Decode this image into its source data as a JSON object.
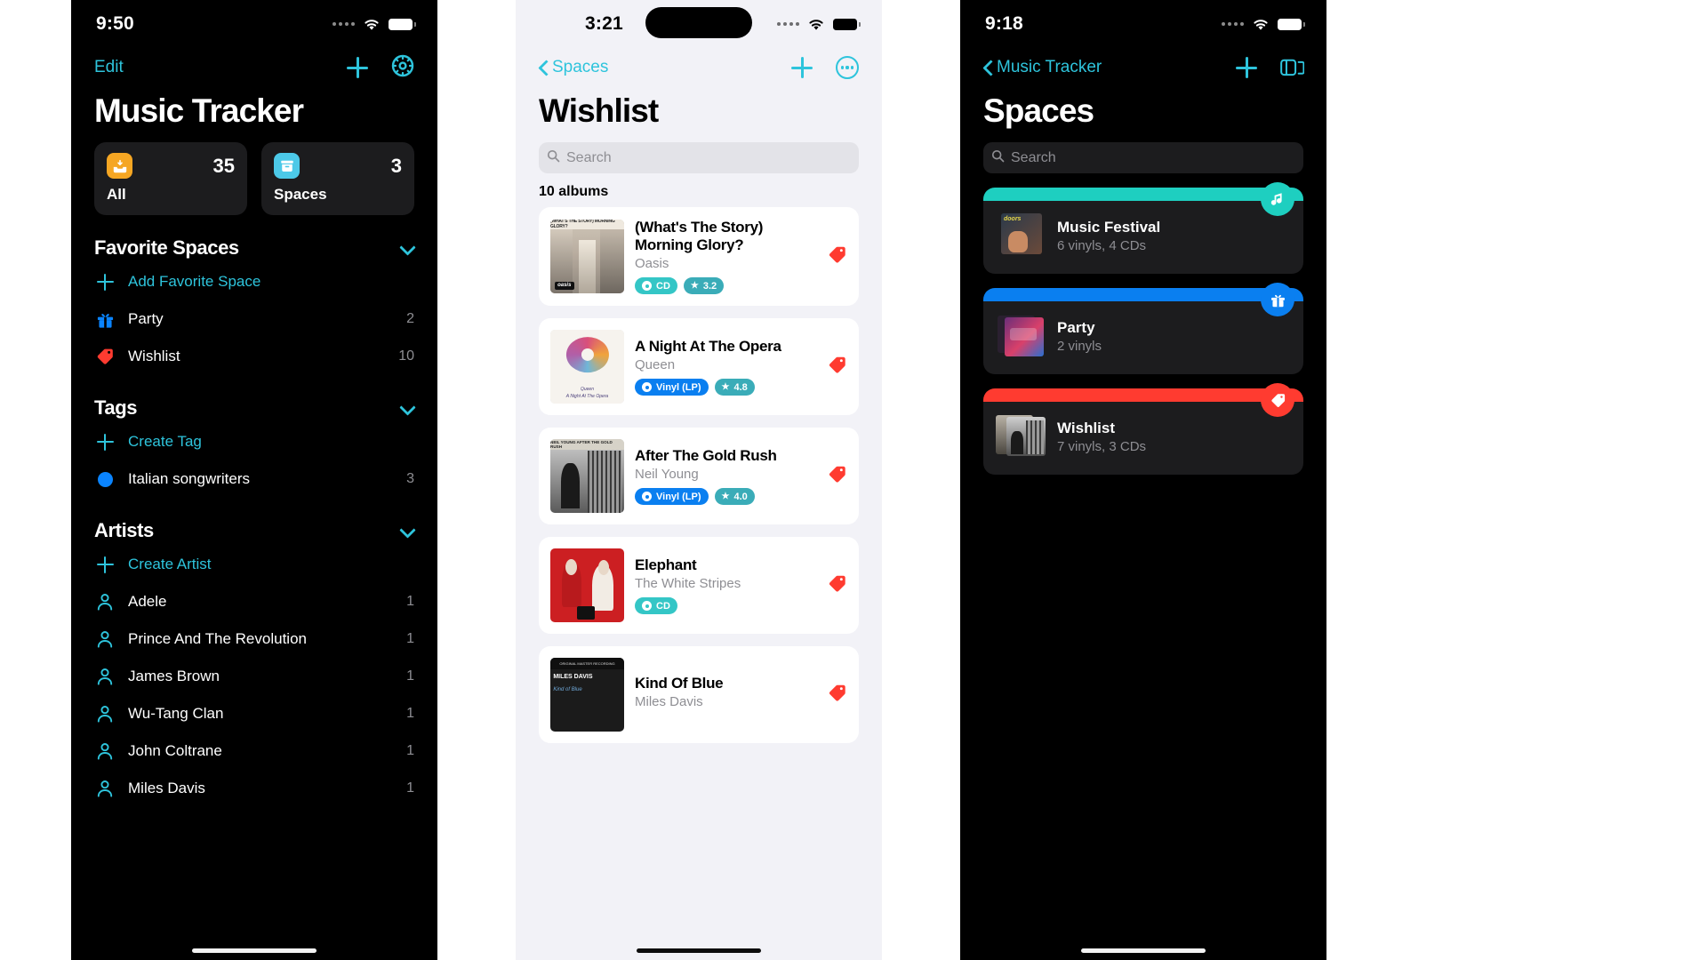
{
  "theme": {
    "accent_teal": "#2ec4dc",
    "accent_blue": "#0a84ff",
    "red": "#ff3b30",
    "orange": "#f5a623",
    "cyan": "#4cc9e8",
    "mint": "#1ecfc0",
    "card_dark": "#1c1c1e",
    "light_bg": "#f2f2f7"
  },
  "panel1": {
    "status": {
      "time": "9:50",
      "signal_icon": "signal-dots-icon",
      "wifi_icon": "wifi-icon",
      "battery_icon": "battery-icon"
    },
    "nav": {
      "edit_label": "Edit",
      "add_icon": "plus-icon",
      "settings_icon": "gear-icon"
    },
    "title": "Music Tracker",
    "stats": [
      {
        "label": "All",
        "count": "35",
        "icon": "inbox-icon",
        "color": "#f5a623"
      },
      {
        "label": "Spaces",
        "count": "3",
        "icon": "archive-box-icon",
        "color": "#4cc9e8"
      }
    ],
    "sections": [
      {
        "title": "Favorite Spaces",
        "collapse_icon": "chevron-down-icon",
        "add_label": "Add Favorite Space",
        "add_icon": "plus-icon",
        "rows": [
          {
            "label": "Party",
            "count": "2",
            "icon": "gift-icon",
            "color": "#0a84ff"
          },
          {
            "label": "Wishlist",
            "count": "10",
            "icon": "tag-icon",
            "color": "#ff3b30"
          }
        ]
      },
      {
        "title": "Tags",
        "collapse_icon": "chevron-down-icon",
        "add_label": "Create Tag",
        "add_icon": "plus-icon",
        "rows": [
          {
            "label": "Italian songwriters",
            "count": "3",
            "icon": "circle-dot-icon",
            "color": "#0a84ff"
          }
        ]
      },
      {
        "title": "Artists",
        "collapse_icon": "chevron-down-icon",
        "add_label": "Create Artist",
        "add_icon": "plus-icon",
        "rows": [
          {
            "label": "Adele",
            "count": "1",
            "icon": "person-icon",
            "color": "#2ec4dc"
          },
          {
            "label": "Prince And The Revolution",
            "count": "1",
            "icon": "person-icon",
            "color": "#2ec4dc"
          },
          {
            "label": "James Brown",
            "count": "1",
            "icon": "person-icon",
            "color": "#2ec4dc"
          },
          {
            "label": "Wu-Tang Clan",
            "count": "1",
            "icon": "person-icon",
            "color": "#2ec4dc"
          },
          {
            "label": "John Coltrane",
            "count": "1",
            "icon": "person-icon",
            "color": "#2ec4dc"
          },
          {
            "label": "Miles Davis",
            "count": "1",
            "icon": "person-icon",
            "color": "#2ec4dc"
          }
        ]
      }
    ]
  },
  "panel2": {
    "status": {
      "time": "3:21",
      "signal_icon": "signal-dots-icon",
      "wifi_icon": "wifi-icon",
      "battery_icon": "battery-icon"
    },
    "nav": {
      "back_label": "Spaces",
      "back_icon": "chevron-left-icon",
      "add_icon": "plus-icon",
      "more_icon": "ellipsis-circle-icon"
    },
    "title": "Wishlist",
    "search_placeholder": "Search",
    "search_icon": "search-icon",
    "count_label": "10 albums",
    "albums": [
      {
        "title": "(What's The Story) Morning Glory?",
        "artist": "Oasis",
        "cover": "morning-glory-cover",
        "badges": [
          {
            "type": "cd",
            "label": "CD"
          },
          {
            "type": "rate",
            "label": "3.2"
          }
        ],
        "tag_icon": "tag-icon"
      },
      {
        "title": "A Night At The Opera",
        "artist": "Queen",
        "cover": "night-at-the-opera-cover",
        "badges": [
          {
            "type": "vinyl",
            "label": "Vinyl (LP)"
          },
          {
            "type": "rate",
            "label": "4.8"
          }
        ],
        "tag_icon": "tag-icon"
      },
      {
        "title": "After The Gold Rush",
        "artist": "Neil Young",
        "cover": "after-the-gold-rush-cover",
        "badges": [
          {
            "type": "vinyl",
            "label": "Vinyl (LP)"
          },
          {
            "type": "rate",
            "label": "4.0"
          }
        ],
        "tag_icon": "tag-icon"
      },
      {
        "title": "Elephant",
        "artist": "The White Stripes",
        "cover": "elephant-cover",
        "badges": [
          {
            "type": "cd",
            "label": "CD"
          }
        ],
        "tag_icon": "tag-icon"
      },
      {
        "title": "Kind Of Blue",
        "artist": "Miles Davis",
        "cover": "kind-of-blue-cover",
        "badges": [],
        "tag_icon": "tag-icon"
      }
    ]
  },
  "panel3": {
    "status": {
      "time": "9:18",
      "signal_icon": "signal-dots-icon",
      "wifi_icon": "wifi-icon",
      "battery_icon": "battery-icon"
    },
    "nav": {
      "back_label": "Music Tracker",
      "back_icon": "chevron-left-icon",
      "add_icon": "plus-icon",
      "layout_icon": "sidebar-layout-icon"
    },
    "title": "Spaces",
    "search_placeholder": "Search",
    "search_icon": "search-icon",
    "spaces": [
      {
        "name": "Music Festival",
        "subtitle": "6 vinyls, 4 CDs",
        "color": "#1ecfc0",
        "badge_icon": "music-note-icon",
        "thumb": "doors-cover"
      },
      {
        "name": "Party",
        "subtitle": "2 vinyls",
        "color": "#0a7ff0",
        "badge_icon": "gift-icon",
        "thumb": "party-cover"
      },
      {
        "name": "Wishlist",
        "subtitle": "7 vinyls, 3 CDs",
        "color": "#ff3b30",
        "badge_icon": "tag-icon",
        "thumb": "wishlist-cover"
      }
    ]
  }
}
